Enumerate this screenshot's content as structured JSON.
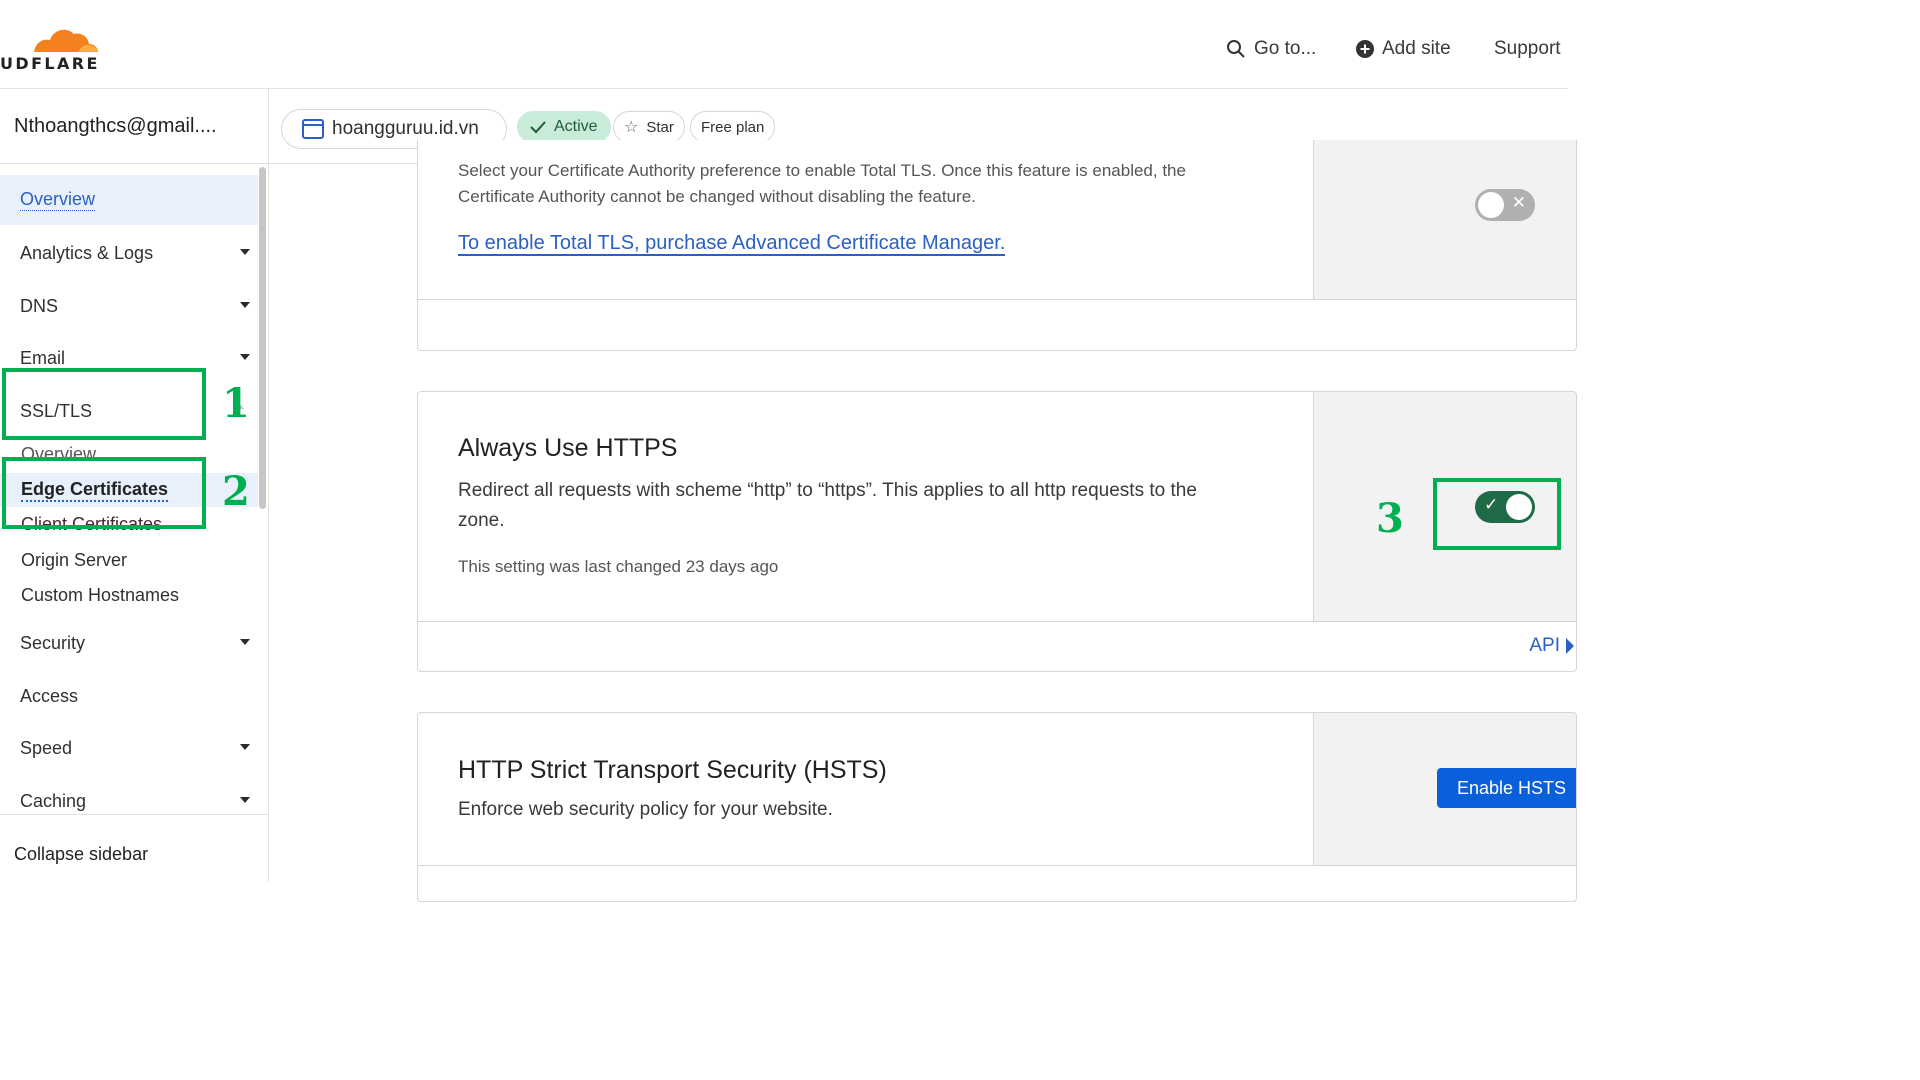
{
  "brand": {
    "wordmark": "UDFLARE"
  },
  "topnav": {
    "goto_label": "Go to...",
    "addsite_label": "Add site",
    "support_label": "Support"
  },
  "account": {
    "name": "Nthoangthcs@gmail...."
  },
  "zone": {
    "domain": "hoangguruu.id.vn",
    "status": "Active",
    "star_label": "Star",
    "plan": "Free plan"
  },
  "sidebar": {
    "items": [
      {
        "label": "Overview"
      },
      {
        "label": "Analytics & Logs"
      },
      {
        "label": "DNS"
      },
      {
        "label": "Email"
      },
      {
        "label": "SSL/TLS"
      },
      {
        "label": "Security"
      },
      {
        "label": "Access"
      },
      {
        "label": "Speed"
      },
      {
        "label": "Caching"
      }
    ],
    "ssl_sub": [
      {
        "label": "Overview"
      },
      {
        "label": "Edge Certificates"
      },
      {
        "label": "Client Certificates"
      },
      {
        "label": "Origin Server"
      },
      {
        "label": "Custom Hostnames"
      }
    ],
    "collapse_label": "Collapse sidebar"
  },
  "total_tls": {
    "desc_line1": "Select your Certificate Authority preference to enable Total TLS. Once this feature is enabled, the",
    "desc_line2": "Certificate Authority cannot be changed without disabling the feature.",
    "link": "To enable Total TLS, purchase Advanced Certificate Manager.",
    "enabled": false
  },
  "always_https": {
    "title": "Always Use HTTPS",
    "desc_line1": "Redirect all requests with scheme “http” to “https”. This applies to all http requests to the",
    "desc_line2": "zone.",
    "changed": "This setting was last changed 23 days ago",
    "enabled": true,
    "api_label": "API"
  },
  "hsts": {
    "title": "HTTP Strict Transport Security (HSTS)",
    "desc": "Enforce web security policy for your website.",
    "button": "Enable HSTS"
  },
  "annotations": {
    "n1": "1",
    "n2": "2",
    "n3": "3"
  },
  "colors": {
    "annotation": "#00b050",
    "link": "#2a60c4",
    "toggle_on": "#1f6b47",
    "primary": "#0a5fdb",
    "brand_orange": "#f48120"
  }
}
